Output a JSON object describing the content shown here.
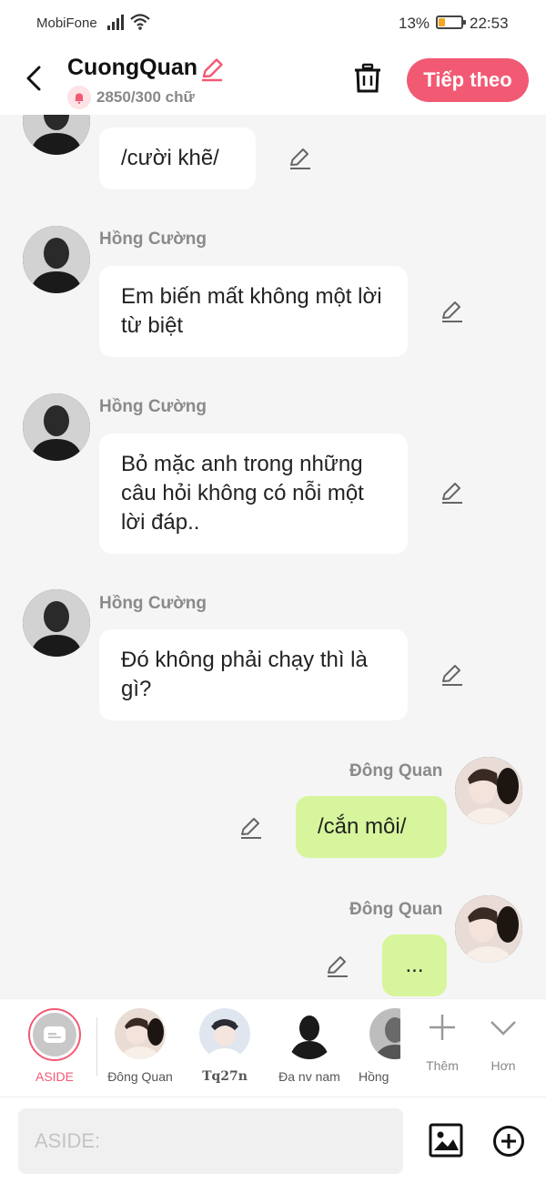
{
  "status": {
    "carrier": "MobiFone",
    "battery": "13%",
    "battery_level": 0.13,
    "time": "22:53"
  },
  "header": {
    "title": "CuongQuan",
    "counter": "2850/300 chữ",
    "next_label": "Tiếp theo"
  },
  "messages": [
    {
      "sender": "",
      "text": "/cười khẽ/"
    },
    {
      "sender": "Hồng Cường",
      "text": "Em biến mất không một lời từ biệt"
    },
    {
      "sender": "Hồng Cường",
      "text": "Bỏ mặc anh trong những câu hỏi không có nỗi một lời đáp.."
    },
    {
      "sender": "Hồng Cường",
      "text": "Đó không phải chạy thì là gì?"
    },
    {
      "sender": "Đông Quan",
      "text": "/cắn môi/"
    },
    {
      "sender": "Đông Quan",
      "text": "..."
    }
  ],
  "characters": {
    "aside": "ASIDE",
    "items": [
      "Đông Quan",
      "Tq27n",
      "Đa nv nam",
      "Hồng"
    ],
    "more_label": "Thêm",
    "expand_label": "Hơn"
  },
  "input": {
    "placeholder": "ASIDE:"
  },
  "colors": {
    "accent": "#f25a74",
    "my_bubble": "#d7f59c"
  }
}
